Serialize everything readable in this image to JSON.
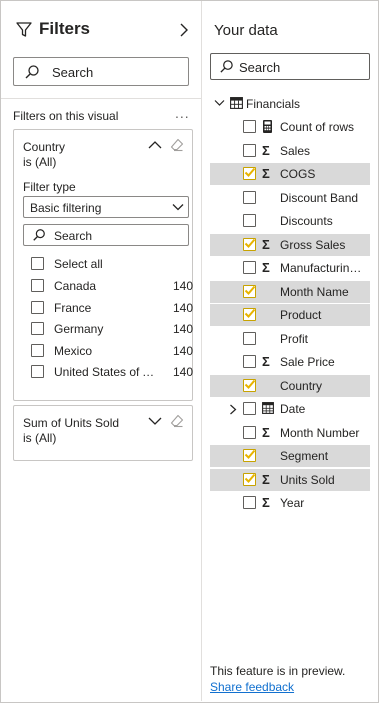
{
  "filters": {
    "title": "Filters",
    "search_placeholder": "Search",
    "section_label": "Filters on this visual",
    "more": "...",
    "cards": [
      {
        "title": "Country",
        "subtitle": "is (All)",
        "filter_type_label": "Filter type",
        "filter_type_value": "Basic filtering",
        "search_placeholder": "Search",
        "select_all": "Select all",
        "items": [
          {
            "label": "Canada",
            "count": "140"
          },
          {
            "label": "France",
            "count": "140"
          },
          {
            "label": "Germany",
            "count": "140"
          },
          {
            "label": "Mexico",
            "count": "140"
          },
          {
            "label": "United States of America",
            "count": "140"
          }
        ]
      },
      {
        "title": "Sum of Units Sold",
        "subtitle": "is (All)"
      }
    ]
  },
  "data_pane": {
    "title": "Your data",
    "search_placeholder": "Search",
    "table": "Financials",
    "fields": [
      {
        "label": "Count of rows",
        "icon": "calculator-icon",
        "checked": false
      },
      {
        "label": "Sales",
        "icon": "sigma-icon",
        "checked": false
      },
      {
        "label": "COGS",
        "icon": "sigma-icon",
        "checked": true
      },
      {
        "label": "Discount Band",
        "icon": "",
        "checked": false
      },
      {
        "label": "Discounts",
        "icon": "",
        "checked": false
      },
      {
        "label": "Gross Sales",
        "icon": "sigma-icon",
        "checked": true
      },
      {
        "label": "Manufacturing Price",
        "icon": "sigma-icon",
        "checked": false
      },
      {
        "label": "Month Name",
        "icon": "",
        "checked": true
      },
      {
        "label": "Product",
        "icon": "",
        "checked": true
      },
      {
        "label": "Profit",
        "icon": "",
        "checked": false
      },
      {
        "label": "Sale Price",
        "icon": "sigma-icon",
        "checked": false
      },
      {
        "label": "Country",
        "icon": "",
        "checked": true
      },
      {
        "label": "Date",
        "icon": "calendar-icon",
        "checked": false,
        "expandable": true
      },
      {
        "label": "Month Number",
        "icon": "sigma-icon",
        "checked": false
      },
      {
        "label": "Segment",
        "icon": "",
        "checked": true
      },
      {
        "label": "Units Sold",
        "icon": "sigma-icon",
        "checked": true
      },
      {
        "label": "Year",
        "icon": "sigma-icon",
        "checked": false
      }
    ],
    "preview_note": "This feature is in preview.",
    "feedback_link": "Share feedback"
  },
  "colors": {
    "selected_row": "#d9d9d9",
    "check_mark": "#e8b400",
    "link": "#1170cf"
  }
}
